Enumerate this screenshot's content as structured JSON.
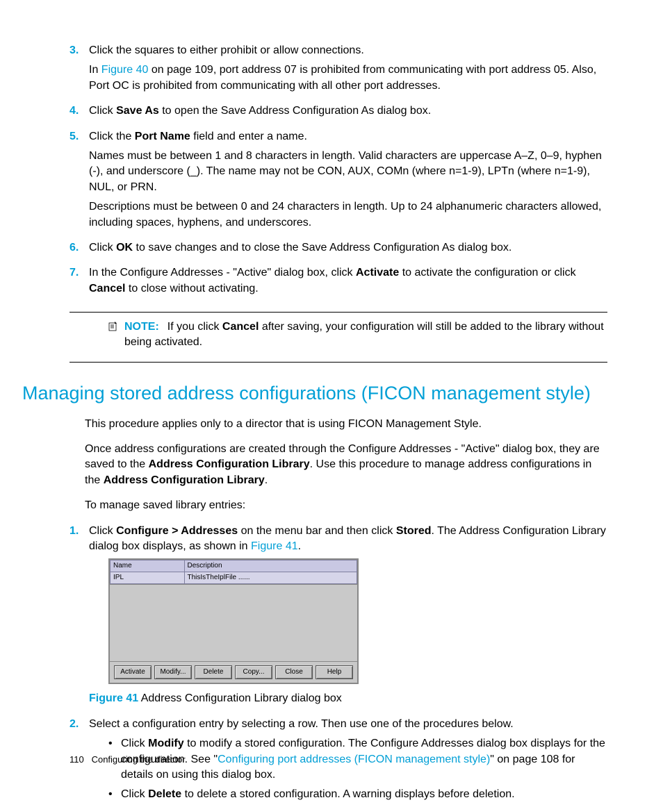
{
  "steps_top": {
    "s3": {
      "num": "3.",
      "line1": "Click the squares to either prohibit or allow connections.",
      "line2a": "In ",
      "fig40": "Figure 40",
      "line2b": " on page 109, port address 07 is prohibited from communicating with port address 05. Also, Port OC is prohibited from communicating with all other port addresses."
    },
    "s4": {
      "num": "4.",
      "a": "Click ",
      "saveas": "Save As",
      "b": " to open the Save Address Configuration As dialog box."
    },
    "s5": {
      "num": "5.",
      "a": "Click the ",
      "portname": "Port Name",
      "b": " field and enter a name.",
      "p2": "Names must be between 1 and 8 characters in length. Valid characters are uppercase A–Z, 0–9, hyphen (-), and underscore (_). The name may not be CON, AUX, COMn (where n=1-9), LPTn (where n=1-9), NUL, or PRN.",
      "p3": "Descriptions must be between 0 and 24 characters in length. Up to 24 alphanumeric characters allowed, including spaces, hyphens, and underscores."
    },
    "s6": {
      "num": "6.",
      "a": "Click ",
      "ok": "OK",
      "b": " to save changes and to close the Save Address Configuration As dialog box."
    },
    "s7": {
      "num": "7.",
      "a": "In the Configure Addresses - \"Active\" dialog box, click ",
      "activate": "Activate",
      "b": " to activate the configuration or click ",
      "cancel": "Cancel",
      "c": " to close without activating."
    }
  },
  "note": {
    "label": "NOTE:",
    "a": "If you click ",
    "cancel": "Cancel",
    "b": " after saving, your configuration will still be added to the library without being activated."
  },
  "heading": "Managing stored address configurations (FICON management style)",
  "p_apply": "This procedure applies only to a director that is using FICON Management Style.",
  "p_once_a": "Once address configurations are created through the Configure Addresses - \"Active\" dialog box, they are saved to the ",
  "acl1": "Address Configuration Library",
  "p_once_b": ". Use this procedure to manage address configurations in the ",
  "acl2": "Address Configuration Library",
  "p_once_c": ".",
  "p_manage": "To manage saved library entries:",
  "steps2": {
    "s1": {
      "num": "1.",
      "a": "Click ",
      "confaddr": "Configure > Addresses",
      "b": " on the menu bar and then click ",
      "stored": "Stored",
      "c": ". The Address Configuration Library dialog box displays, as shown in ",
      "fig41": "Figure 41",
      "d": "."
    },
    "s2": {
      "num": "2.",
      "line": "Select a configuration entry by selecting a row. Then use one of the procedures below.",
      "b1a": "Click ",
      "modify": "Modify",
      "b1b": " to modify a stored configuration. The Configure Addresses dialog box displays for the configuration. See \"",
      "b1link": "Configuring port addresses (FICON management style)",
      "b1c": "\" on page 108 for details on using this dialog box.",
      "b2a": "Click ",
      "delete": "Delete",
      "b2b": " to delete a stored configuration. A warning displays before deletion."
    }
  },
  "dialog": {
    "col_name": "Name",
    "col_desc": "Description",
    "row_name": "IPL",
    "row_desc": "ThisIsTheIplFile ......",
    "btns": {
      "activate": "Activate",
      "modify": "Modify...",
      "delete": "Delete",
      "copy": "Copy...",
      "close": "Close",
      "help": "Help"
    }
  },
  "fig41": {
    "label": "Figure 41",
    "caption": " Address Configuration Library dialog box"
  },
  "footer": {
    "page": "110",
    "chapter": "Configuring the director"
  }
}
